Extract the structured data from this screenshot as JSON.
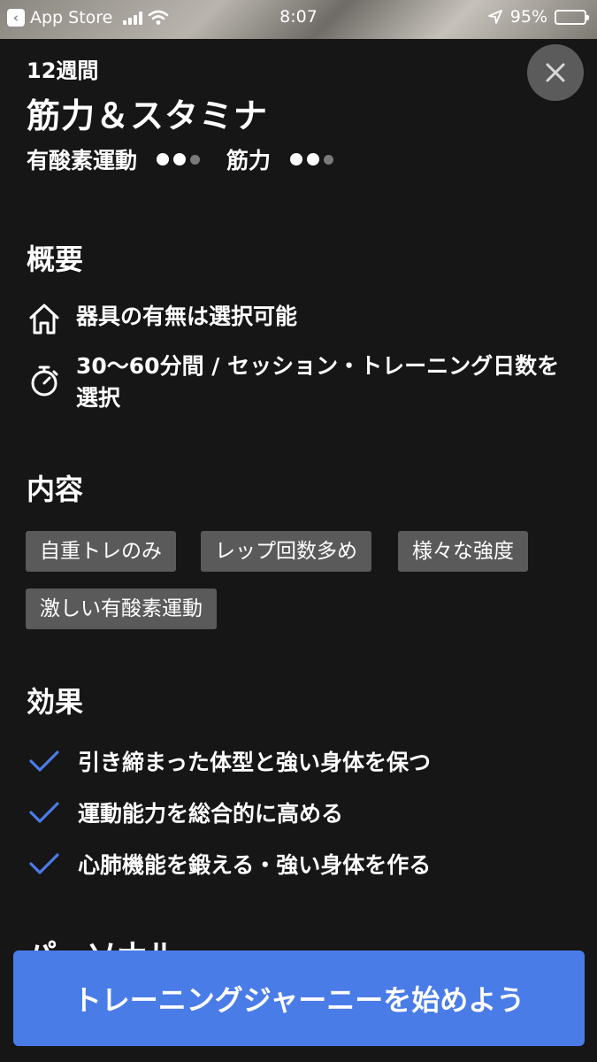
{
  "status_bar": {
    "back_label": "App Store",
    "time": "8:07",
    "battery": "95%"
  },
  "program": {
    "duration": "12週間",
    "title": "筋力＆スタミナ",
    "intensity": [
      {
        "label": "有酸素運動",
        "level": 2,
        "max": 3
      },
      {
        "label": "筋力",
        "level": 2,
        "max": 3
      }
    ]
  },
  "overview": {
    "heading": "概要",
    "items": [
      {
        "icon": "home-icon",
        "text": "器具の有無は選択可能"
      },
      {
        "icon": "stopwatch-icon",
        "text": "30〜60分間 / セッション・トレーニング日数を選択"
      }
    ]
  },
  "content": {
    "heading": "内容",
    "tags": [
      "自重トレのみ",
      "レップ回数多め",
      "様々な強度",
      "激しい有酸素運動"
    ]
  },
  "effects": {
    "heading": "効果",
    "items": [
      "引き締まった体型と強い身体を保つ",
      "運動能力を総合的に高める",
      "心肺機能を鍛える・強い身体を作る"
    ]
  },
  "next_section_heading": "パーソナル",
  "cta_label": "トレーニングジャーニーを始めよう",
  "colors": {
    "background": "#161616",
    "accent": "#4a7ce8",
    "tag_bg": "#5a5a5a",
    "check": "#4a7ce8"
  }
}
